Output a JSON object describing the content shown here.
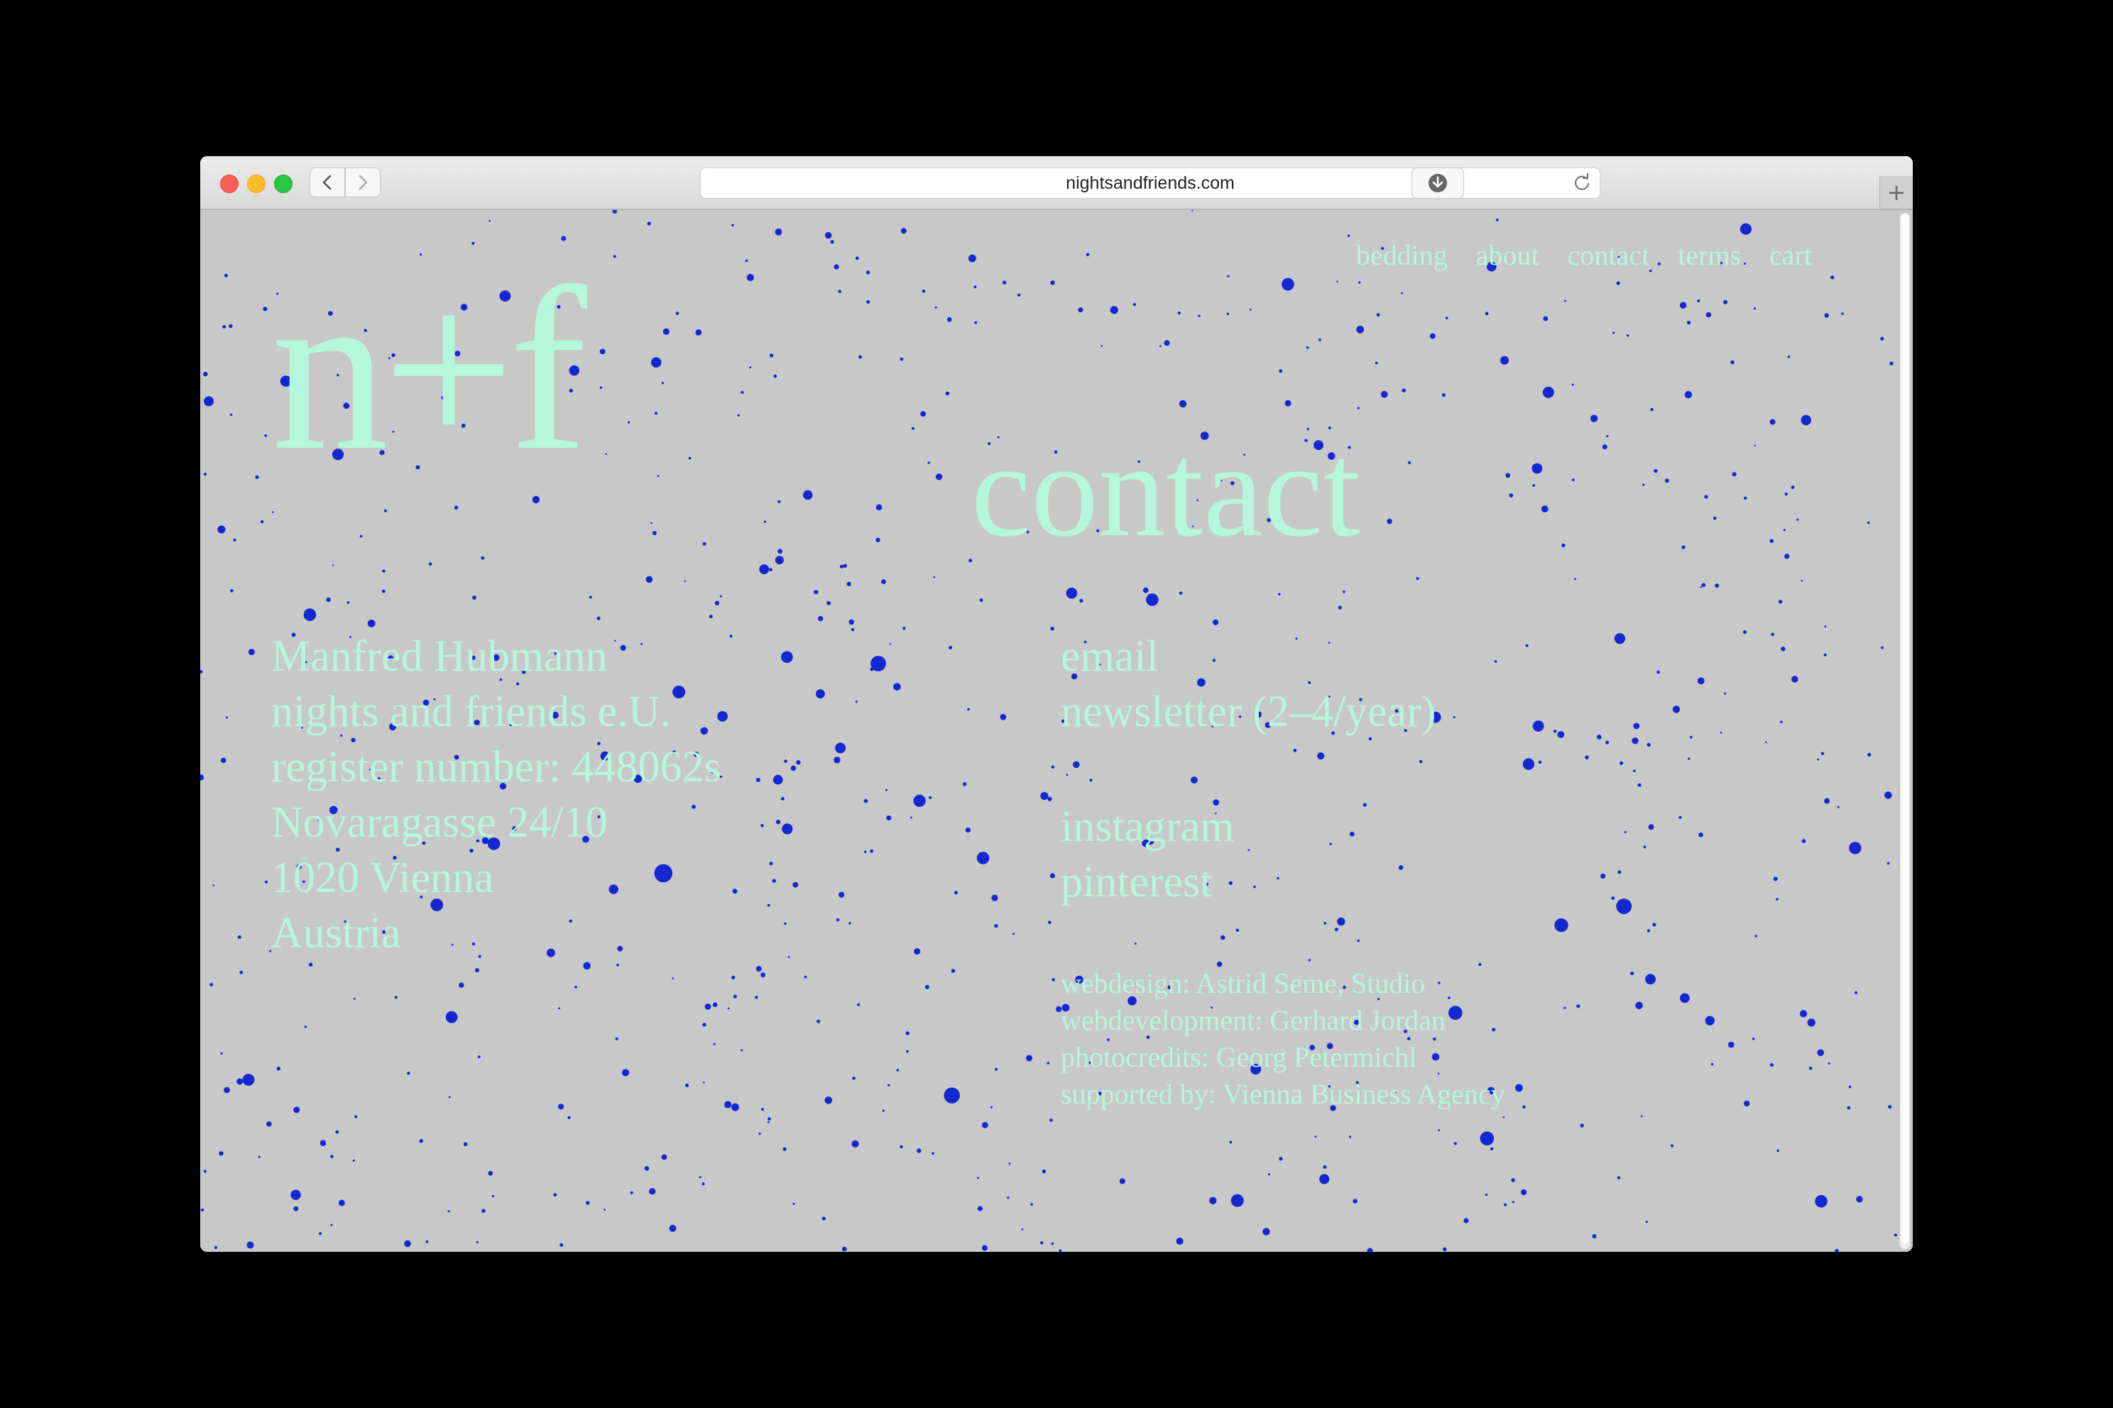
{
  "browser": {
    "url": "nightsandfriends.com",
    "newtab_label": "+"
  },
  "colors": {
    "background": "#c8c8c8",
    "accent_text": "#b5f7dc",
    "speckle": "#1428d2",
    "outer": "#000000"
  },
  "icons": {
    "back": "chevron-left-icon",
    "forward": "chevron-right-icon",
    "reload": "reload-icon",
    "download": "download-icon"
  },
  "nav": {
    "items": [
      "bedding",
      "about",
      "contact",
      "terms",
      "cart"
    ]
  },
  "logo": "n+f",
  "page_title": "contact",
  "address": {
    "lines": [
      "Manfred Hubmann",
      "nights and friends e.U.",
      "register number: 448062s",
      "Novaragasse 24/10",
      "1020 Vienna",
      "Austria"
    ]
  },
  "links": {
    "email": "email",
    "newsletter": "newsletter (2–4/year)",
    "instagram": "instagram",
    "pinterest": "pinterest"
  },
  "credits": {
    "lines": [
      "webdesign: Astrid Seme, Studio",
      "webdevelopment: Gerhard Jordan",
      "photocredits: Georg Petermichl",
      "supported by: Vienna Business Agency"
    ]
  }
}
